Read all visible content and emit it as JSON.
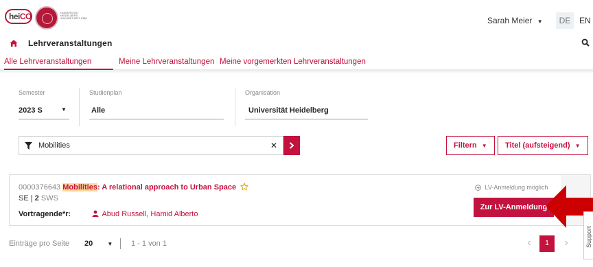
{
  "header": {
    "logo_text": "heiCO",
    "seal_text": "UNIVERSITÄT HEIDELBERG ZUKUNFT SEIT 1386",
    "user_name": "Sarah Meier",
    "lang_de": "DE",
    "lang_en": "EN"
  },
  "page": {
    "title": "Lehrveranstaltungen"
  },
  "tabs": [
    {
      "label": "Alle Lehrveranstaltungen",
      "active": true
    },
    {
      "label": "Meine Lehrveranstaltungen",
      "active": false
    },
    {
      "label": "Meine vorgemerkten Lehrveranstaltungen",
      "active": false
    }
  ],
  "filters": {
    "semester_label": "Semester",
    "semester_value": "2023 S",
    "studienplan_label": "Studienplan",
    "studienplan_value": "Alle",
    "organisation_label": "Organisation",
    "organisation_value": "Universität Heidelberg"
  },
  "search": {
    "value": "Mobilities",
    "filter_button": "Filtern",
    "sort_button": "Titel (aufsteigend)"
  },
  "course": {
    "id": "0000376643",
    "title_highlight": "Mobilities",
    "title_rest": ": A relational approach to Urban Space",
    "type": "SE",
    "separator": "|",
    "sws_value": "2",
    "sws_unit": "SWS",
    "lecturers_label": "Vortragende*r:",
    "lecturers": "Abud Russell, Hamid Alberto",
    "status": "LV-Anmeldung möglich",
    "enroll_button": "Zur LV-Anmeldung"
  },
  "support": {
    "label": "Support"
  },
  "footer": {
    "per_page_label": "Einträge pro Seite",
    "per_page_value": "20",
    "range": "1 - 1 von 1",
    "current_page": "1"
  },
  "colors": {
    "accent": "#c4123e",
    "highlight": "#fdd99b",
    "arrow": "#cc0000"
  }
}
